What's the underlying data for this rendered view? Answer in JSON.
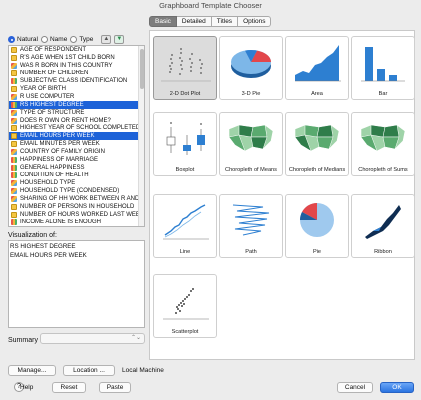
{
  "window": {
    "title": "Graphboard Template Chooser"
  },
  "sort": {
    "options": [
      "Natural",
      "Name",
      "Type"
    ],
    "selected": "Natural",
    "up_icon": "▲",
    "down_icon": "▼"
  },
  "variables": [
    {
      "label": "AGE OF RESPONDENT",
      "type": "scale",
      "selected": false
    },
    {
      "label": "R'S AGE WHEN 1ST CHILD BORN",
      "type": "scale",
      "selected": false
    },
    {
      "label": "WAS R BORN IN THIS COUNTRY",
      "type": "nominal",
      "selected": false
    },
    {
      "label": "NUMBER OF CHILDREN",
      "type": "scale",
      "selected": false
    },
    {
      "label": "SUBJECTIVE CLASS IDENTIFICATION",
      "type": "ordinal",
      "selected": false
    },
    {
      "label": "YEAR OF BIRTH",
      "type": "scale",
      "selected": false
    },
    {
      "label": "R USE COMPUTER",
      "type": "nominal",
      "selected": false
    },
    {
      "label": "RS HIGHEST DEGREE",
      "type": "ordinal",
      "selected": true
    },
    {
      "label": "TYPE OF STRUCTURE",
      "type": "nominal",
      "selected": false
    },
    {
      "label": "DOES R OWN OR RENT HOME?",
      "type": "nominal",
      "selected": false
    },
    {
      "label": "HIGHEST YEAR OF SCHOOL COMPLETED",
      "type": "scale",
      "selected": false
    },
    {
      "label": "EMAIL HOURS PER WEEK",
      "type": "scale",
      "selected": true
    },
    {
      "label": "EMAIL MINUTES PER WEEK",
      "type": "scale",
      "selected": false
    },
    {
      "label": "COUNTRY OF FAMILY ORIGIN",
      "type": "nominal",
      "selected": false
    },
    {
      "label": "HAPPINESS OF MARRIAGE",
      "type": "ordinal",
      "selected": false
    },
    {
      "label": "GENERAL HAPPINESS",
      "type": "ordinal",
      "selected": false
    },
    {
      "label": "CONDITION OF HEALTH",
      "type": "ordinal",
      "selected": false
    },
    {
      "label": "HOUSEHOLD TYPE",
      "type": "nominal",
      "selected": false
    },
    {
      "label": "HOUSEHOLD TYPE (CONDENSED)",
      "type": "nominal",
      "selected": false
    },
    {
      "label": "SHARING OF HH WORK BETWEEN R AND S",
      "type": "nominal",
      "selected": false
    },
    {
      "label": "NUMBER OF PERSONS IN HOUSEHOLD",
      "type": "scale",
      "selected": false
    },
    {
      "label": "NUMBER OF HOURS WORKED LAST WEEK",
      "type": "scale",
      "selected": false
    },
    {
      "label": "INCOME ALONE IS ENOUGH",
      "type": "ordinal",
      "selected": false
    }
  ],
  "visualization": {
    "label": "Visualization of:",
    "items": [
      "RS HIGHEST DEGREE",
      "EMAIL HOURS PER WEEK"
    ]
  },
  "summary": {
    "label": "Summary :",
    "value": ""
  },
  "tabs": [
    {
      "label": "Basic",
      "active": true
    },
    {
      "label": "Detailed",
      "active": false
    },
    {
      "label": "Titles",
      "active": false
    },
    {
      "label": "Options",
      "active": false
    }
  ],
  "templates": [
    {
      "label": "2-D Dot Plot",
      "icon": "dot-plot",
      "selected": true
    },
    {
      "label": "3-D Pie",
      "icon": "pie-3d",
      "selected": false
    },
    {
      "label": "Area",
      "icon": "area",
      "selected": false
    },
    {
      "label": "Bar",
      "icon": "bar",
      "selected": false
    },
    {
      "label": "Boxplot",
      "icon": "boxplot",
      "selected": false
    },
    {
      "label": "Choropleth of Means",
      "icon": "map",
      "selected": false
    },
    {
      "label": "Choropleth of Medians",
      "icon": "map",
      "selected": false
    },
    {
      "label": "Choropleth of Sums",
      "icon": "map",
      "selected": false
    },
    {
      "label": "Line",
      "icon": "line",
      "selected": false
    },
    {
      "label": "Path",
      "icon": "path",
      "selected": false
    },
    {
      "label": "Pie",
      "icon": "pie",
      "selected": false
    },
    {
      "label": "Ribbon",
      "icon": "ribbon",
      "selected": false
    },
    {
      "label": "Scatterplot",
      "icon": "scatter",
      "selected": false
    }
  ],
  "buttons": {
    "manage": "Manage...",
    "location": "Location ...",
    "local_label": "Local Machine",
    "help": "?",
    "help_text": "Help",
    "reset": "Reset",
    "paste": "Paste",
    "cancel": "Cancel",
    "ok": "OK"
  },
  "colors": {
    "selection": "#1d62d8",
    "thumb_blue": "#2d7fd1",
    "map_green": "#2f7d4a",
    "ok_button": "#2a74e0"
  }
}
